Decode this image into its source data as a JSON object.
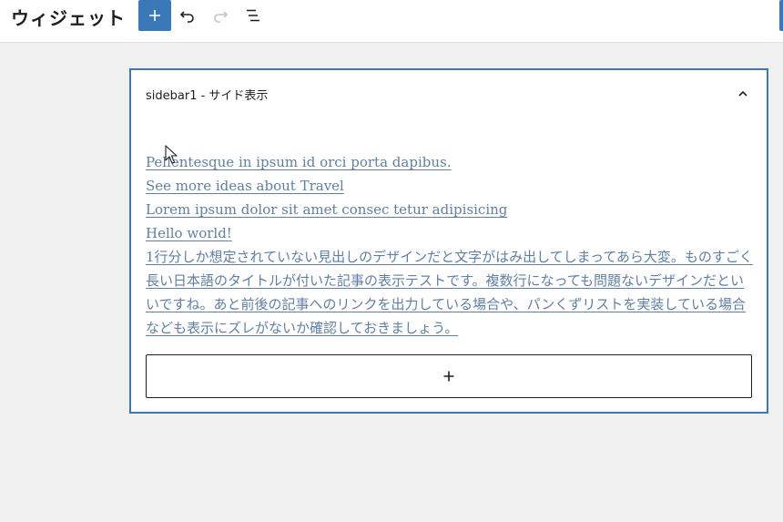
{
  "header": {
    "title": "ウィジェット",
    "add_icon": "plus-icon",
    "undo_icon": "undo-icon",
    "redo_icon": "redo-icon",
    "listview_icon": "list-view-icon",
    "accent_color": "#3a78b7"
  },
  "widget_area": {
    "title": "sidebar1 - サイド表示",
    "collapse_icon": "chevron-up-icon",
    "posts": [
      {
        "label": "Pellentesque in ipsum id orci porta dapibus."
      },
      {
        "label": "See more ideas about Travel"
      },
      {
        "label": "Lorem ipsum dolor sit amet consec tetur adipisicing"
      },
      {
        "label": "Hello world!"
      },
      {
        "label": "1行分しか想定されていない見出しのデザインだと文字がはみ出してしまってあら大変。ものすごく長い日本語のタイトルが付いた記事の表示テストです。複数行になっても問題ないデザインだといいですね。あと前後の記事へのリンクを出力している場合や、パンくずリストを実装している場合なども表示にズレがないか確認しておきましょう。"
      }
    ],
    "appender_icon": "plus-icon",
    "link_color": "#5f7fa8"
  }
}
